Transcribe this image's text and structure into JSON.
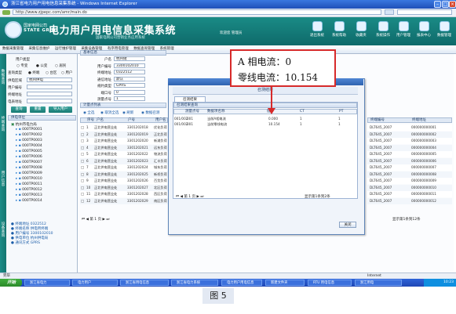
{
  "window": {
    "title": "浙江省电力用户用电信息采集系统 - Windows Internet Explorer",
    "address": "http://www.zjpepc.com/amr/main.do"
  },
  "banner": {
    "company_cn": "国家电网公司",
    "company_en": "STATE GRID",
    "app_title": "电力用户用电信息采集系统",
    "app_subtitle": "国家电网公司营销业务应用系统",
    "user_info": "欢迎您 管理员",
    "toolbar": [
      "退出系统",
      "系统帮助",
      "收藏夹",
      "系统操作",
      "用户管理",
      "报表中心",
      "数据管理"
    ]
  },
  "menu": [
    "数据采集管理",
    "采集信息维护",
    "运行维护管理",
    "采集设备管理",
    "有序用电管理",
    "数据查询管理",
    "系统管理"
  ],
  "left": {
    "vtabs": [
      "数据查询",
      "终端查询",
      "用户信息",
      "设备查询"
    ],
    "search": {
      "type_label": "用户类型",
      "options": [
        "专变",
        "公变",
        "居民"
      ],
      "mode_label": "查询类型",
      "mode_options": [
        "终端",
        "台区",
        "用户"
      ],
      "name_label": "供电区域",
      "name_value": "杭州供电",
      "id_label": "用户编号",
      "addr_label": "终端地址",
      "meter_label": "电表地址",
      "btn_query": "查询",
      "btn_reset": "重置",
      "btn_import": "导入用户"
    },
    "tree_header": "供电单位",
    "tree_root": "杭州市电力局",
    "tree_items": [
      "000TP0001",
      "000TP0002",
      "000TP0003",
      "000TP0004",
      "000TP0005",
      "000TP0006",
      "000TP0007",
      "000TP0008",
      "000TP0009",
      "000TP0010",
      "000TP0011",
      "000TP0012",
      "000TP0013",
      "000TP0014"
    ],
    "info": [
      {
        "k": "终端地址",
        "v": "0322512"
      },
      {
        "k": "终端名称",
        "v": "供电所终端"
      },
      {
        "k": "用户编号",
        "v": "3300102010"
      },
      {
        "k": "供电单位",
        "v": "杭州供电局"
      },
      {
        "k": "通讯方式",
        "v": "GPRS"
      }
    ]
  },
  "main": {
    "form_header": "基本信息",
    "form": [
      {
        "k": "户名",
        "v": "杭州储"
      },
      {
        "k": "用户编号",
        "v": "3300102010"
      },
      {
        "k": "终端地址",
        "v": "0322512"
      },
      {
        "k": "通信地址",
        "v": "默认"
      },
      {
        "k": "规约类型",
        "v": "GPRS"
      },
      {
        "k": "端口号",
        "v": "0"
      },
      {
        "k": "测量点号",
        "v": "1"
      }
    ],
    "list_header": "计量点列表",
    "list_toolbar": [
      "全选",
      "取消全选",
      "刷新",
      "数据召测"
    ],
    "list_columns": [
      "序号",
      "户名",
      "户号",
      "用户名",
      "地址"
    ],
    "list_rows": [
      [
        "1",
        "正北供电营业处",
        "3301202018",
        "优化负荷"
      ],
      [
        "2",
        "正北供电营业处",
        "3301202019",
        "正北负荷"
      ],
      [
        "3",
        "正北供电营业处",
        "3301202020",
        "新浦负荷"
      ],
      [
        "4",
        "正北供电营业处",
        "3301202021",
        "远东负荷"
      ],
      [
        "5",
        "正北供电营业处",
        "3301202022",
        "物流负荷"
      ],
      [
        "6",
        "正北供电营业处",
        "3301202023",
        "汇丰负荷"
      ],
      [
        "7",
        "正北供电营业处",
        "3301202024",
        "城东负荷"
      ],
      [
        "8",
        "正北供电营业处",
        "3301202025",
        "新桥负荷"
      ],
      [
        "9",
        "正北供电营业处",
        "3301202026",
        "百货负荷"
      ],
      [
        "10",
        "正北供电营业处",
        "3301202027",
        "北区负荷"
      ],
      [
        "11",
        "正北供电营业处",
        "3301202028",
        "西区负荷"
      ],
      [
        "12",
        "正北供电营业处",
        "3301202029",
        "南区负荷"
      ]
    ],
    "pager_text": "第 1 页",
    "right_columns": [
      "终端编号",
      "终端地址"
    ],
    "right_rows": [
      [
        "DLT645_2007",
        "000000000001"
      ],
      [
        "DLT645_2007",
        "000000000002"
      ],
      [
        "DLT645_2007",
        "000000000003"
      ],
      [
        "DLT645_2007",
        "000000000004"
      ],
      [
        "DLT645_2007",
        "000000000005"
      ],
      [
        "DLT645_2007",
        "000000000006"
      ],
      [
        "DLT645_2007",
        "000000000007"
      ],
      [
        "DLT645_2007",
        "000000000008"
      ],
      [
        "DLT645_2007",
        "000000000009"
      ],
      [
        "DLT645_2007",
        "000000000010"
      ],
      [
        "DLT645_2007",
        "000000000011"
      ],
      [
        "DLT645_2007",
        "000000000012"
      ]
    ],
    "right_pager": "显示第1条到12条",
    "dialog": {
      "title": "召测结果",
      "tab": "召测结果",
      "grid_header": "召测结果查询",
      "columns": [
        "测量点号",
        "数据项名称",
        "值",
        "CT",
        "PT"
      ],
      "rows": [
        {
          "no": "001/002",
          "mp": "001",
          "name": "当前A相电流",
          "value": "0.000",
          "ct": "1",
          "pt": "1"
        },
        {
          "no": "001/002",
          "mp": "001",
          "name": "当前零线电流",
          "value": "10.154",
          "ct": "1",
          "pt": "1"
        }
      ],
      "pager": "第 1 页",
      "pager_right": "显示第1条到2条",
      "close_label": "关闭"
    }
  },
  "annotation": {
    "line1": "A 相电流：0",
    "line2": "零线电流：10.154",
    "color": "#d72a2a"
  },
  "status": {
    "left": "完毕",
    "right": "Internet"
  },
  "taskbar": {
    "start": "开始",
    "items": [
      "浙江省电力",
      "电力用户",
      "浙江省用电信息",
      "浙江省电力系统",
      "电力用户用电信息",
      "新建文件夹",
      "RTU 用电信息",
      "浙江用电"
    ],
    "clock": "10:23"
  },
  "caption": "图 5"
}
